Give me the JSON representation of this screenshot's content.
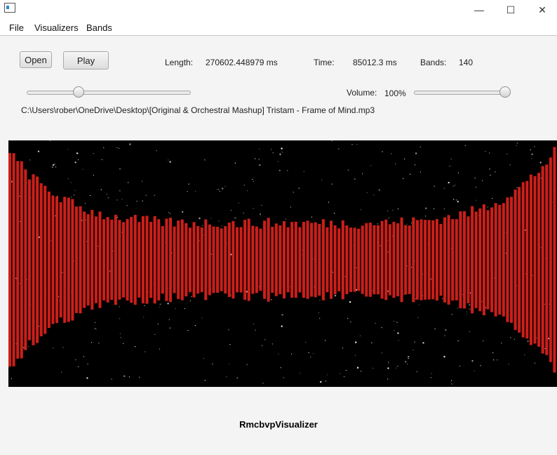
{
  "window": {
    "controls": {
      "minimize": "—",
      "maximize": "☐",
      "close": "✕"
    }
  },
  "menu": [
    "File",
    "Visualizers",
    "Bands"
  ],
  "controls": {
    "open_label": "Open",
    "play_label": "Play",
    "length_label": "Length:",
    "length_value": "270602.448979 ms",
    "time_label": "Time:",
    "time_value": "85012.3 ms",
    "bands_label": "Bands:",
    "bands_value": "140",
    "volume_label": "Volume:",
    "volume_value": "100%",
    "progress_fraction": 0.314,
    "volume_fraction": 1.0
  },
  "file_path": "C:\\Users\\rober\\OneDrive\\Desktop\\[Original & Orchestral Mashup] Tristam - Frame of Mind.mp3",
  "visualizer": {
    "name": "RmcbvpVisualizer",
    "band_count": 140,
    "bar_color": "#cc1f1a",
    "background": "#000000"
  }
}
